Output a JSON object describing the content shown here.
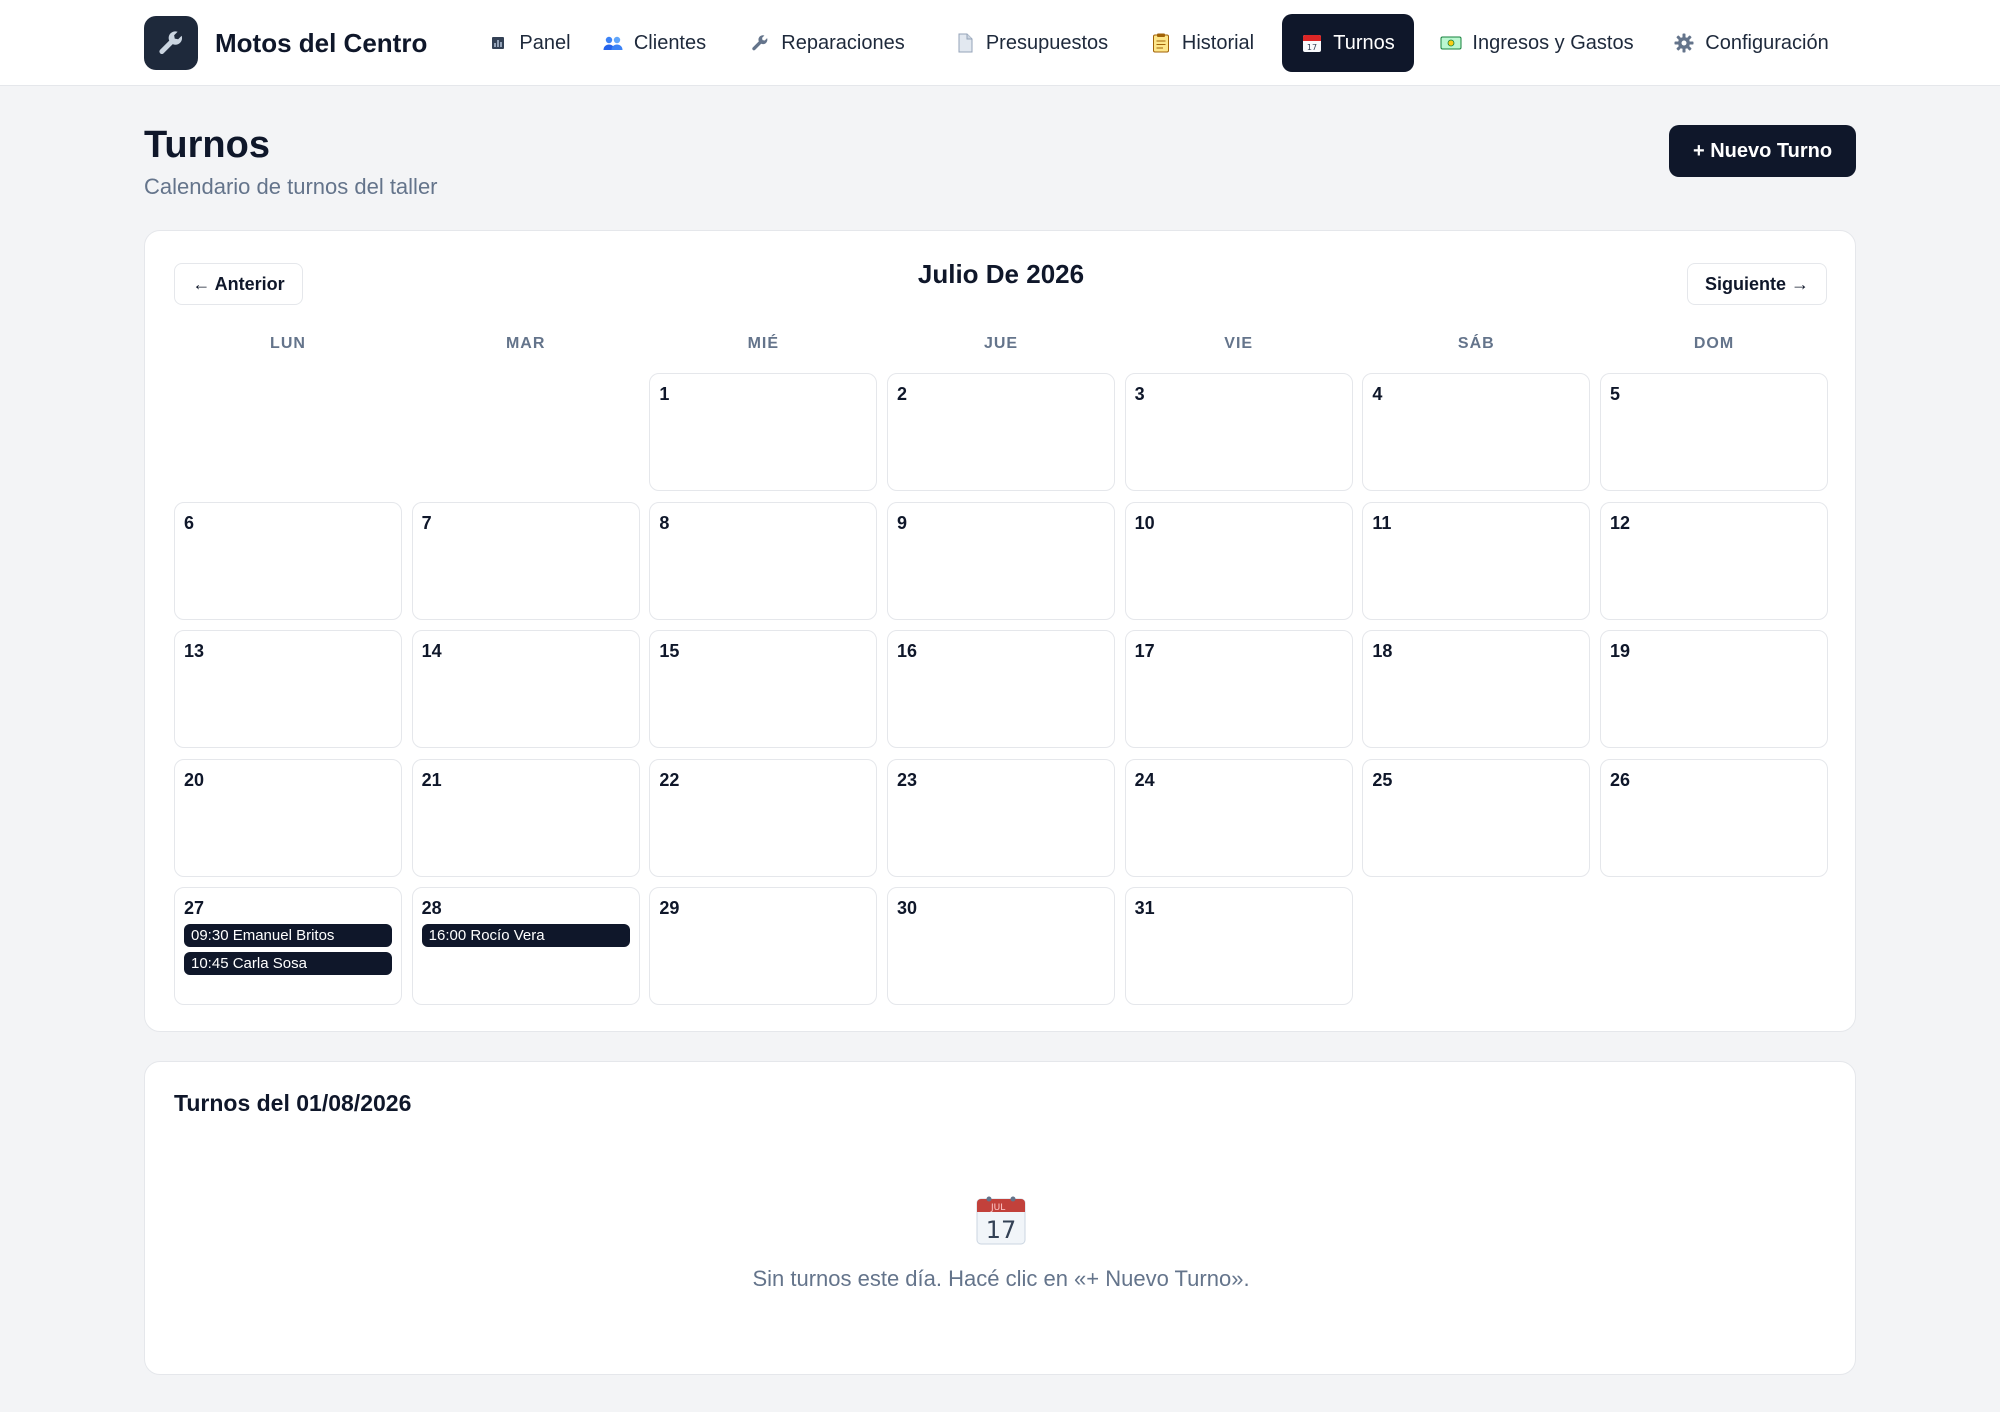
{
  "app": {
    "brand": "Motos del Centro",
    "brand_icon": "wrench-icon"
  },
  "nav": [
    {
      "label": "Panel",
      "icon": "chart-square-icon",
      "active": false
    },
    {
      "label": "Clientes",
      "icon": "users-icon",
      "active": false
    },
    {
      "label": "Reparaciones",
      "icon": "wrench-icon",
      "active": false
    },
    {
      "label": "Presupuestos",
      "icon": "document-icon",
      "active": false
    },
    {
      "label": "Historial",
      "icon": "clipboard-icon",
      "active": false
    },
    {
      "label": "Turnos",
      "icon": "calendar-icon",
      "active": true
    },
    {
      "label": "Ingresos y Gastos",
      "icon": "money-icon",
      "active": false
    },
    {
      "label": "Configuración",
      "icon": "gear-icon",
      "active": false
    }
  ],
  "header": {
    "title": "Turnos",
    "subtitle": "Calendario de turnos del taller",
    "new_button": "+ Nuevo Turno"
  },
  "calendar": {
    "month_title": "Julio De 2026",
    "prev_label": "← Anterior",
    "next_label": "Siguiente →",
    "weekdays": [
      "LUN",
      "MAR",
      "MIÉ",
      "JUE",
      "VIE",
      "SÁB",
      "DOM"
    ],
    "first_weekday_index": 2,
    "days_in_month": 31,
    "appointments": [
      {
        "day": 27,
        "label": "09:30 Emanuel Britos"
      },
      {
        "day": 27,
        "label": "10:45 Carla Sosa"
      },
      {
        "day": 28,
        "label": "16:00 Rocío Vera"
      }
    ]
  },
  "day_detail": {
    "title": "Turnos del 01/08/2026",
    "empty_icon": "calendar-icon",
    "empty_text": "Sin turnos este día. Hacé clic en «+ Nuevo Turno»."
  },
  "colors": {
    "primary": "#0f172a",
    "background": "#f3f4f6",
    "muted_text": "#64748b",
    "border": "#e5e7eb"
  }
}
